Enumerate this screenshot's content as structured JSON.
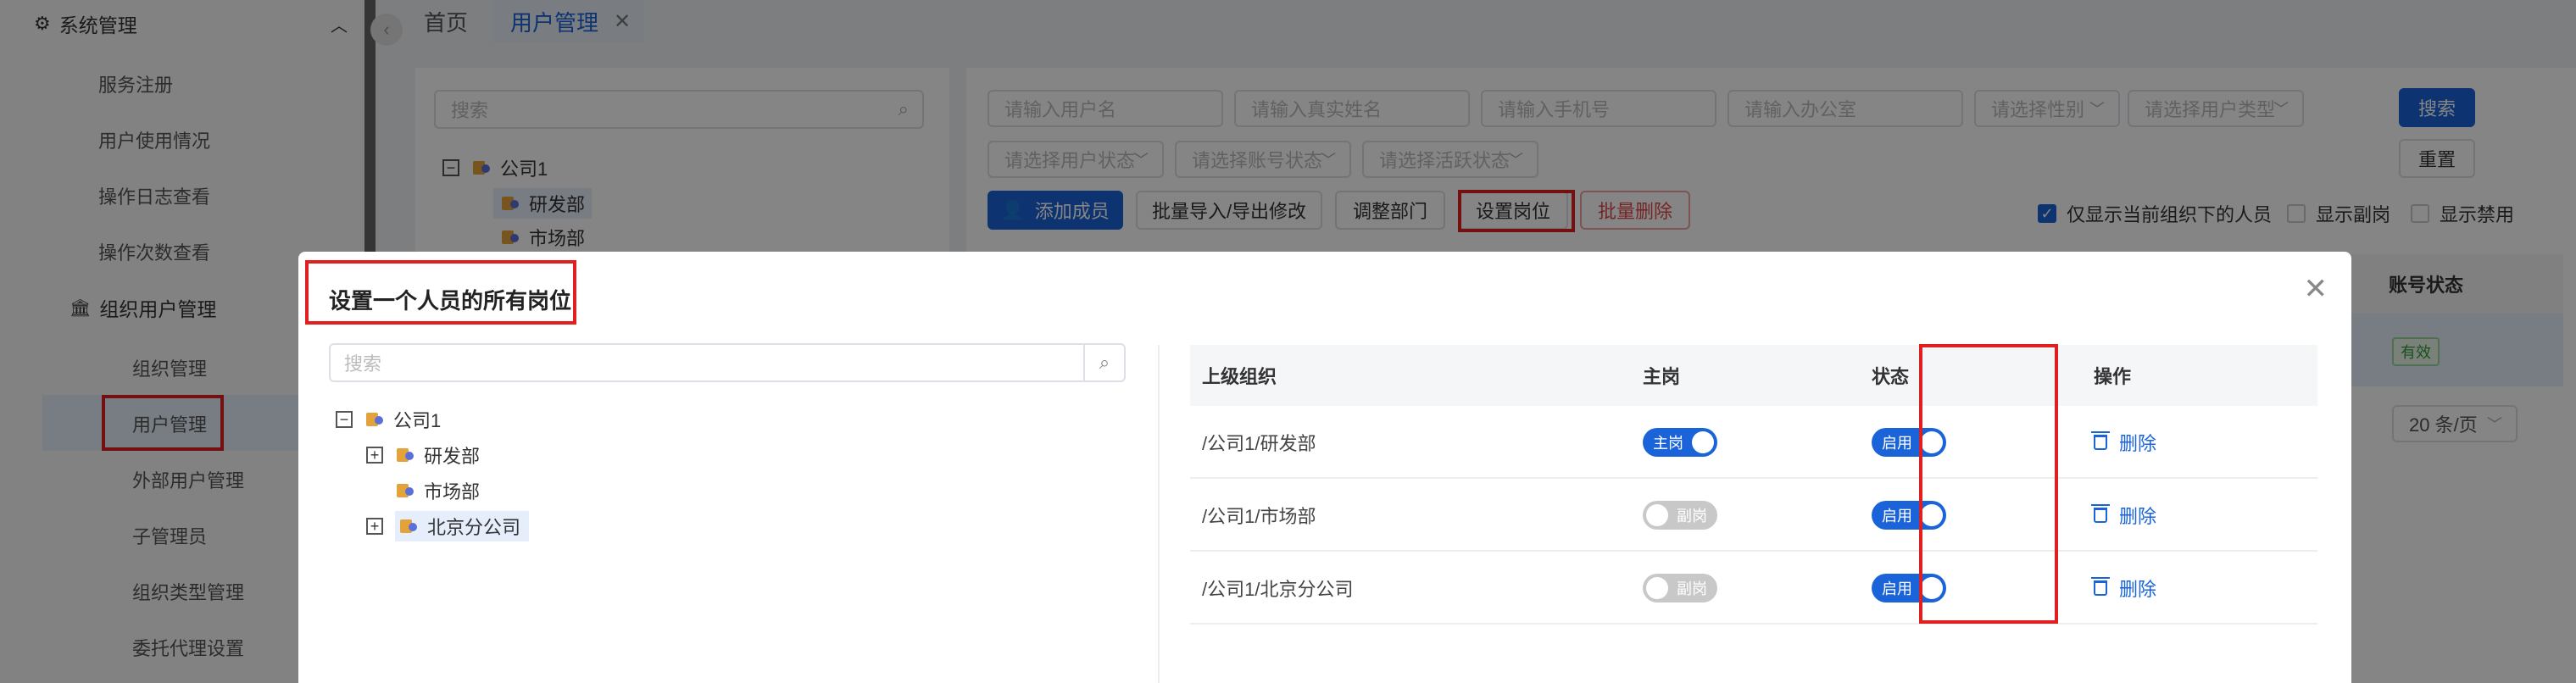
{
  "sidebar": {
    "group_label": "系统管理",
    "items_top": [
      "服务注册",
      "用户使用情况",
      "操作日志查看",
      "操作次数查看"
    ],
    "org_group_label": "组织用户管理",
    "items_sub": [
      "组织管理",
      "用户管理",
      "外部用户管理",
      "子管理员",
      "组织类型管理",
      "委托代理设置"
    ]
  },
  "tabs": {
    "home": "首页",
    "user": "用户管理"
  },
  "bg": {
    "tree_search_placeholder": "搜索",
    "tree": [
      "公司1",
      "研发部",
      "市场部"
    ],
    "filters_row1": [
      "请输入用户名",
      "请输入真实姓名",
      "请输入手机号",
      "请输入办公室",
      "请选择性别",
      "请选择用户类型"
    ],
    "filters_row2": [
      "请选择用户状态",
      "请选择账号状态",
      "请选择活跃状态"
    ],
    "search_btn": "搜索",
    "reset_btn": "重置",
    "actions": [
      "添加成员",
      "批量导入/导出修改",
      "调整部门",
      "设置岗位",
      "批量删除"
    ],
    "checks": [
      "仅显示当前组织下的人员",
      "显示副岗",
      "显示禁用"
    ],
    "col_account_status": "账号状态",
    "status_valid": "有效",
    "page_size": "20 条/页"
  },
  "dialog": {
    "title": "设置一个人员的所有岗位",
    "search_placeholder": "搜索",
    "tree": {
      "root": "公司1",
      "children": [
        "研发部",
        "市场部",
        "北京分公司"
      ]
    },
    "columns": [
      "上级组织",
      "主岗",
      "状态",
      "操作"
    ],
    "rows": [
      {
        "org": "/公司1/研发部",
        "main": "主岗",
        "status": "启用",
        "op": "删除"
      },
      {
        "org": "/公司1/市场部",
        "main": "副岗",
        "status": "启用",
        "op": "删除"
      },
      {
        "org": "/公司1/北京分公司",
        "main": "副岗",
        "status": "启用",
        "op": "删除"
      }
    ]
  },
  "colors": {
    "primary": "#1a63d8",
    "highlight": "#e02020",
    "danger": "#e04848"
  }
}
